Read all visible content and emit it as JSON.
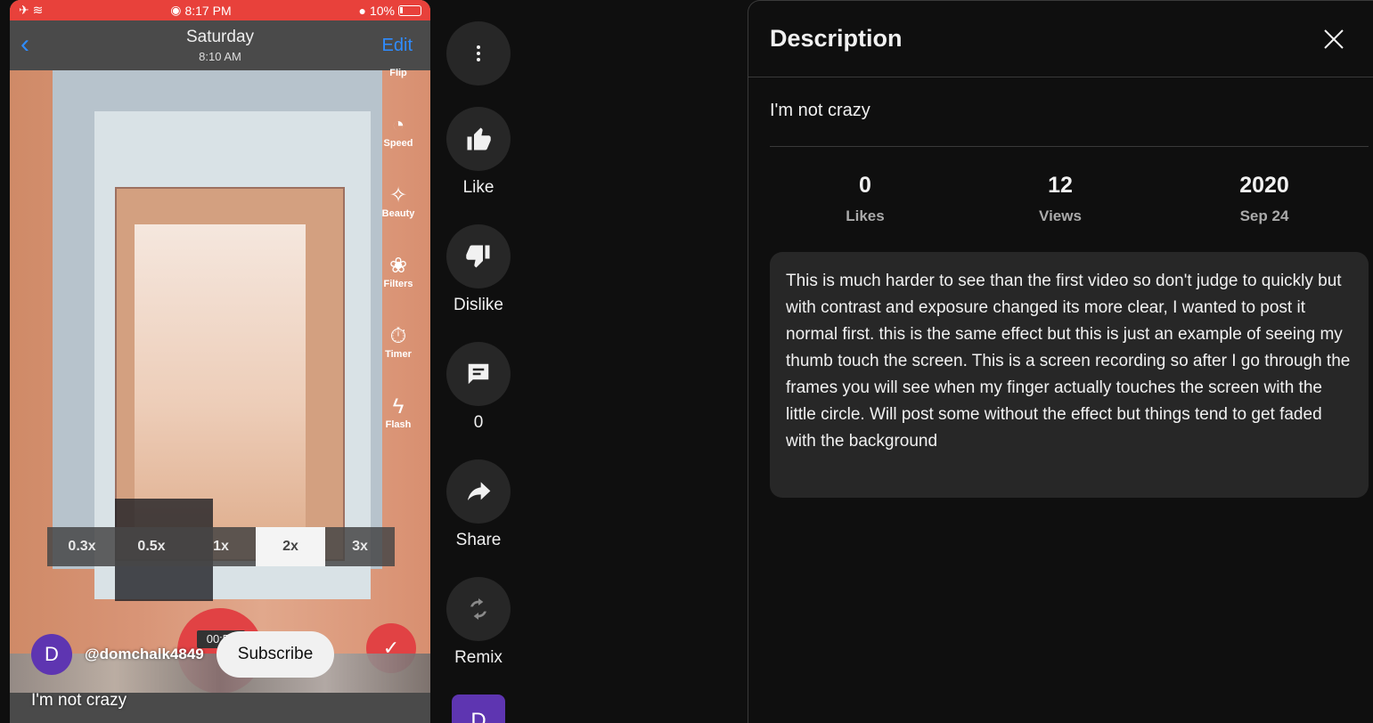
{
  "phone": {
    "status_time": "8:17 PM",
    "battery": "10%",
    "nav_day": "Saturday",
    "nav_time": "8:10 AM",
    "nav_edit": "Edit",
    "tools": [
      {
        "label": "Flip",
        "icon": "flip-icon"
      },
      {
        "label": "Speed",
        "icon": "speed-icon"
      },
      {
        "label": "Beauty",
        "icon": "beauty-icon"
      },
      {
        "label": "Filters",
        "icon": "filters-icon"
      },
      {
        "label": "Timer",
        "icon": "timer-icon"
      },
      {
        "label": "Flash",
        "icon": "flash-icon"
      }
    ],
    "zoom_levels": [
      "0.3x",
      "0.5x",
      "1x",
      "2x",
      "3x"
    ],
    "zoom_selected": "2x",
    "record_time": "00:54"
  },
  "video": {
    "channel_initial": "D",
    "channel_handle": "@domchalk4849",
    "subscribe_label": "Subscribe",
    "title": "I'm not crazy"
  },
  "actions": {
    "more_icon": "more-vert-icon",
    "like_label": "Like",
    "dislike_label": "Dislike",
    "comments_count": "0",
    "share_label": "Share",
    "remix_label": "Remix",
    "avatar_initial": "D"
  },
  "panel": {
    "header": "Description",
    "video_title": "I'm not crazy",
    "stats": [
      {
        "value": "0",
        "label": "Likes"
      },
      {
        "value": "12",
        "label": "Views"
      },
      {
        "value": "2020",
        "label": "Sep 24"
      }
    ],
    "description": "This is much harder to see than the first video so don't judge to quickly but with contrast and exposure changed its more clear, I wanted to post it normal first. this is the same effect but this is just an example of seeing my thumb touch the screen. This is a screen recording so after I go through the frames you will see when my finger actually touches the screen with the little circle. Will post some without the effect but things tend to get faded with the background"
  },
  "colors": {
    "background": "#0f0f0f",
    "surface": "#272727",
    "text": "#f1f1f1",
    "muted": "#aaaaaa",
    "ios_red": "#e8413b",
    "ios_blue": "#2f8cff",
    "avatar_purple": "#5e35b1"
  }
}
